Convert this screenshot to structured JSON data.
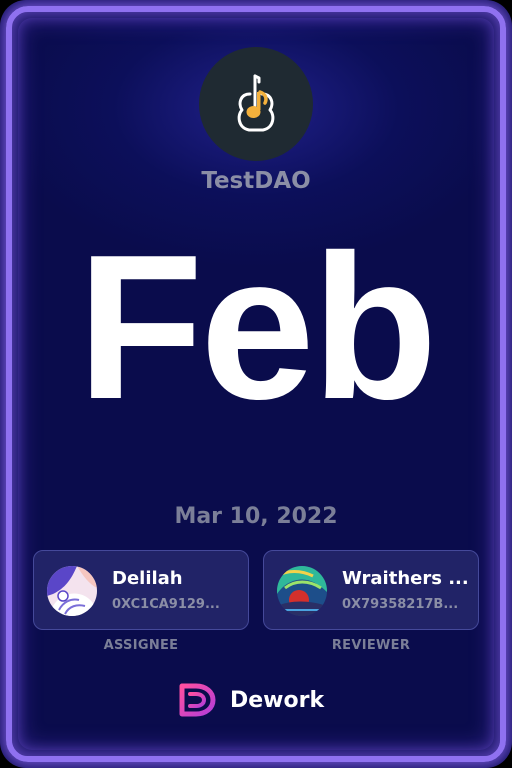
{
  "organization": {
    "name": "TestDAO",
    "logo_icon": "guitar-icon"
  },
  "task": {
    "month": "Feb",
    "date": "Mar 10, 2022"
  },
  "assignee": {
    "name": "Delilah",
    "address": "0XC1CA9129...",
    "role": "ASSIGNEE",
    "avatar_icon": "avatar-illustration"
  },
  "reviewer": {
    "name": "Wraithers ...",
    "address": "0X79358217B...",
    "role": "REVIEWER",
    "avatar_icon": "avatar-illustration"
  },
  "brand": {
    "name": "Dework",
    "logo_icon": "dework-logo-icon"
  },
  "colors": {
    "background": "#0c0f5a",
    "frame": "#8f71f0",
    "logo_accent": "#f4b13c",
    "muted_text": "#8b8ea6"
  }
}
